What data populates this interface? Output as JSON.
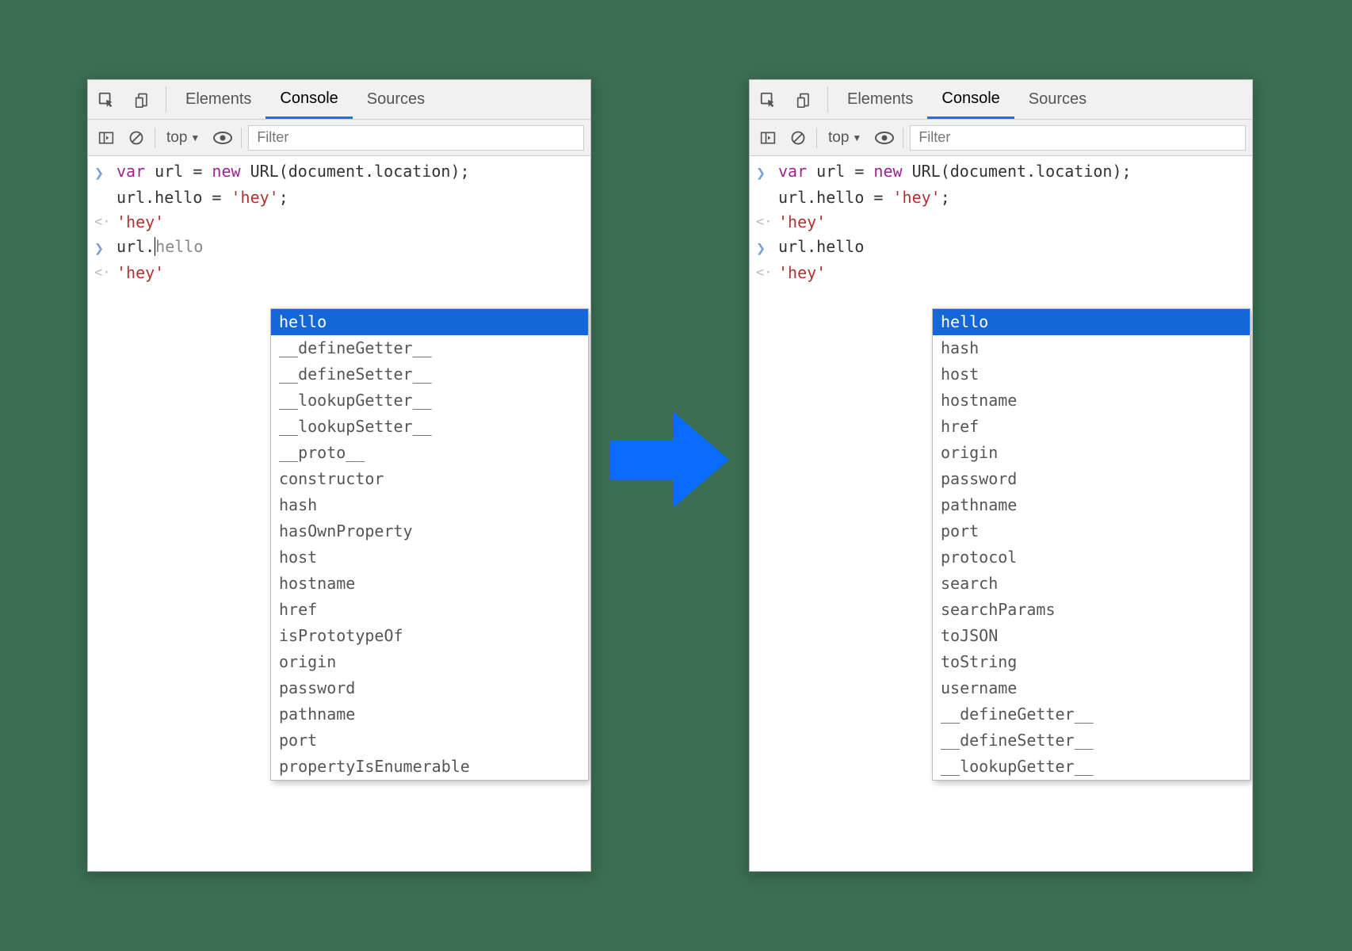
{
  "tabs": {
    "elements": "Elements",
    "console": "Console",
    "sources": "Sources"
  },
  "filterbar": {
    "context": "top",
    "filter_placeholder": "Filter"
  },
  "code": {
    "line1_var": "var",
    "line1_mid": " url = ",
    "line1_new": "new",
    "line1_rest": " URL(document.location);",
    "line2": "url.hello = ",
    "line2_str": "'hey'",
    "line2_end": ";",
    "return1": "'hey'",
    "input_left": "url.",
    "input_left_hl": "hello",
    "input_right": "url.hello",
    "return2": "'hey'"
  },
  "ac_left": [
    "hello",
    "__defineGetter__",
    "__defineSetter__",
    "__lookupGetter__",
    "__lookupSetter__",
    "__proto__",
    "constructor",
    "hash",
    "hasOwnProperty",
    "host",
    "hostname",
    "href",
    "isPrototypeOf",
    "origin",
    "password",
    "pathname",
    "port",
    "propertyIsEnumerable"
  ],
  "ac_right": [
    "hello",
    "hash",
    "host",
    "hostname",
    "href",
    "origin",
    "password",
    "pathname",
    "port",
    "protocol",
    "search",
    "searchParams",
    "toJSON",
    "toString",
    "username",
    "__defineGetter__",
    "__defineSetter__",
    "__lookupGetter__"
  ]
}
